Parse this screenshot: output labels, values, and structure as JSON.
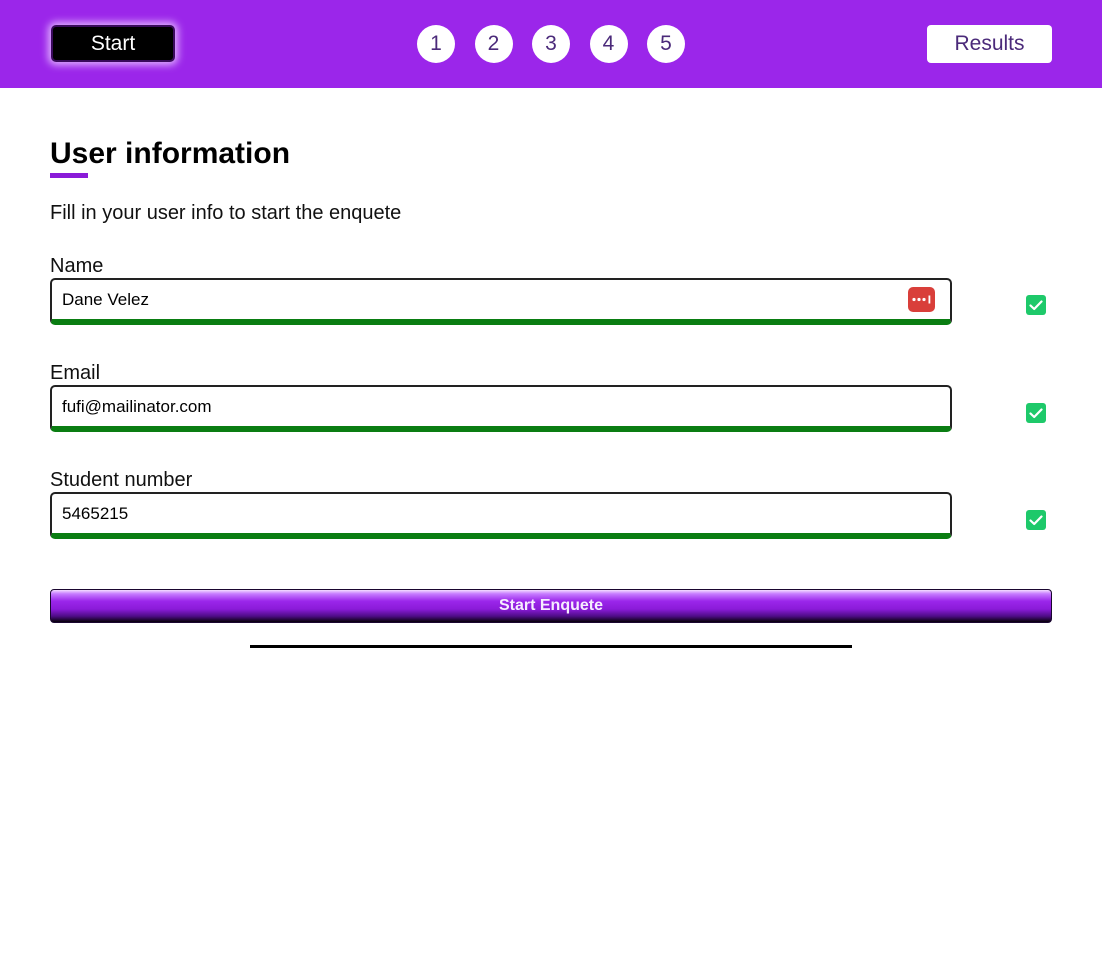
{
  "header": {
    "start_label": "Start",
    "steps": [
      "1",
      "2",
      "3",
      "4",
      "5"
    ],
    "results_label": "Results"
  },
  "form": {
    "title": "User information",
    "intro": "Fill in your user info to start the enquete",
    "fields": [
      {
        "label": "Name",
        "value": "Dane Velez",
        "valid": true,
        "password_manager_icon": "password-manager-icon"
      },
      {
        "label": "Email",
        "value": "fufi@mailinator.com",
        "valid": true
      },
      {
        "label": "Student number",
        "value": "5465215",
        "valid": true
      }
    ],
    "submit_label": "Start Enquete"
  },
  "colors": {
    "header_bg": "#9b26ea",
    "accent": "#8a1bd8",
    "valid_border": "#0a7d12",
    "check_green": "#1ec96a",
    "password_manager_red": "#d93f3a"
  }
}
